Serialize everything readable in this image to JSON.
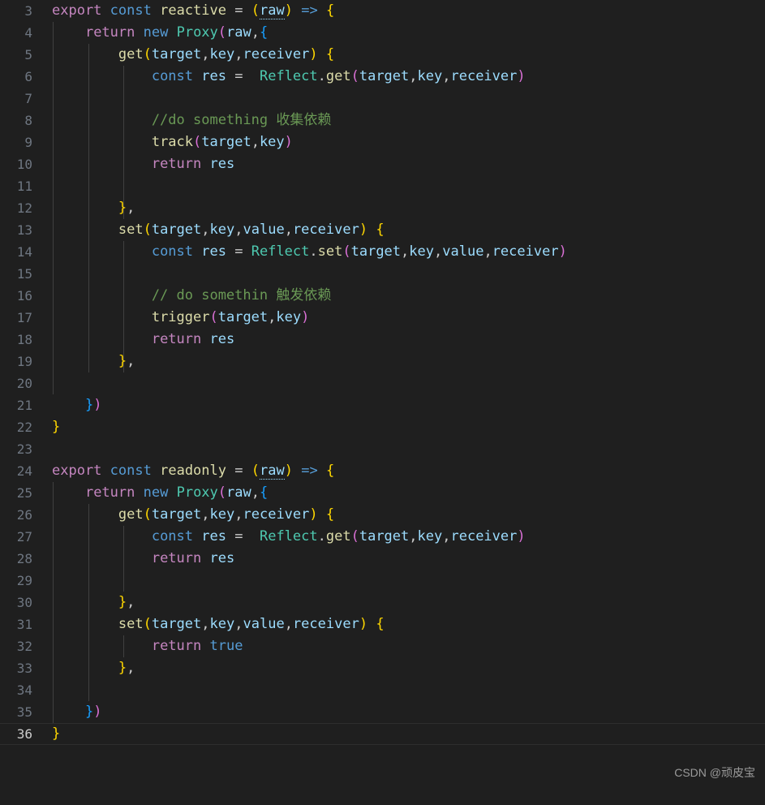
{
  "editor": {
    "background": "#1f1f1f",
    "first_line": 3,
    "last_line": 36,
    "active_line": 36,
    "indent_guides": [
      65,
      109,
      152
    ],
    "colors": {
      "keyword": "#c586c0",
      "keyword_blue": "#569cd6",
      "function": "#dcdcaa",
      "class": "#4ec9b0",
      "variable": "#9cdcfe",
      "comment": "#6a9955",
      "operator": "#cccccc",
      "bracket_level_1": "#ffd700",
      "bracket_level_2": "#da70d6",
      "bracket_level_3": "#179fff",
      "line_number": "#6e7681",
      "line_number_active": "#cccccc"
    },
    "lines": [
      {
        "n": 3,
        "text": "export const reactive = (raw) => {"
      },
      {
        "n": 4,
        "text": "    return new Proxy(raw,{"
      },
      {
        "n": 5,
        "text": "        get(target,key,receiver) {"
      },
      {
        "n": 6,
        "text": "            const res =  Reflect.get(target,key,receiver)"
      },
      {
        "n": 7,
        "text": ""
      },
      {
        "n": 8,
        "text": "            //do something 收集依赖"
      },
      {
        "n": 9,
        "text": "            track(target,key)"
      },
      {
        "n": 10,
        "text": "            return res"
      },
      {
        "n": 11,
        "text": ""
      },
      {
        "n": 12,
        "text": "        },"
      },
      {
        "n": 13,
        "text": "        set(target,key,value,receiver) {"
      },
      {
        "n": 14,
        "text": "            const res = Reflect.set(target,key,value,receiver)"
      },
      {
        "n": 15,
        "text": ""
      },
      {
        "n": 16,
        "text": "            // do somethin 触发依赖"
      },
      {
        "n": 17,
        "text": "            trigger(target,key)"
      },
      {
        "n": 18,
        "text": "            return res"
      },
      {
        "n": 19,
        "text": "        },"
      },
      {
        "n": 20,
        "text": ""
      },
      {
        "n": 21,
        "text": "    })"
      },
      {
        "n": 22,
        "text": "}"
      },
      {
        "n": 23,
        "text": ""
      },
      {
        "n": 24,
        "text": "export const readonly = (raw) => {"
      },
      {
        "n": 25,
        "text": "    return new Proxy(raw,{"
      },
      {
        "n": 26,
        "text": "        get(target,key,receiver) {"
      },
      {
        "n": 27,
        "text": "            const res =  Reflect.get(target,key,receiver)"
      },
      {
        "n": 28,
        "text": "            return res"
      },
      {
        "n": 29,
        "text": ""
      },
      {
        "n": 30,
        "text": "        },"
      },
      {
        "n": 31,
        "text": "        set(target,key,value,receiver) {"
      },
      {
        "n": 32,
        "text": "            return true"
      },
      {
        "n": 33,
        "text": "        },"
      },
      {
        "n": 34,
        "text": ""
      },
      {
        "n": 35,
        "text": "    })"
      },
      {
        "n": 36,
        "text": "}"
      }
    ]
  },
  "watermark": {
    "text": "CSDN @顽皮宝"
  }
}
